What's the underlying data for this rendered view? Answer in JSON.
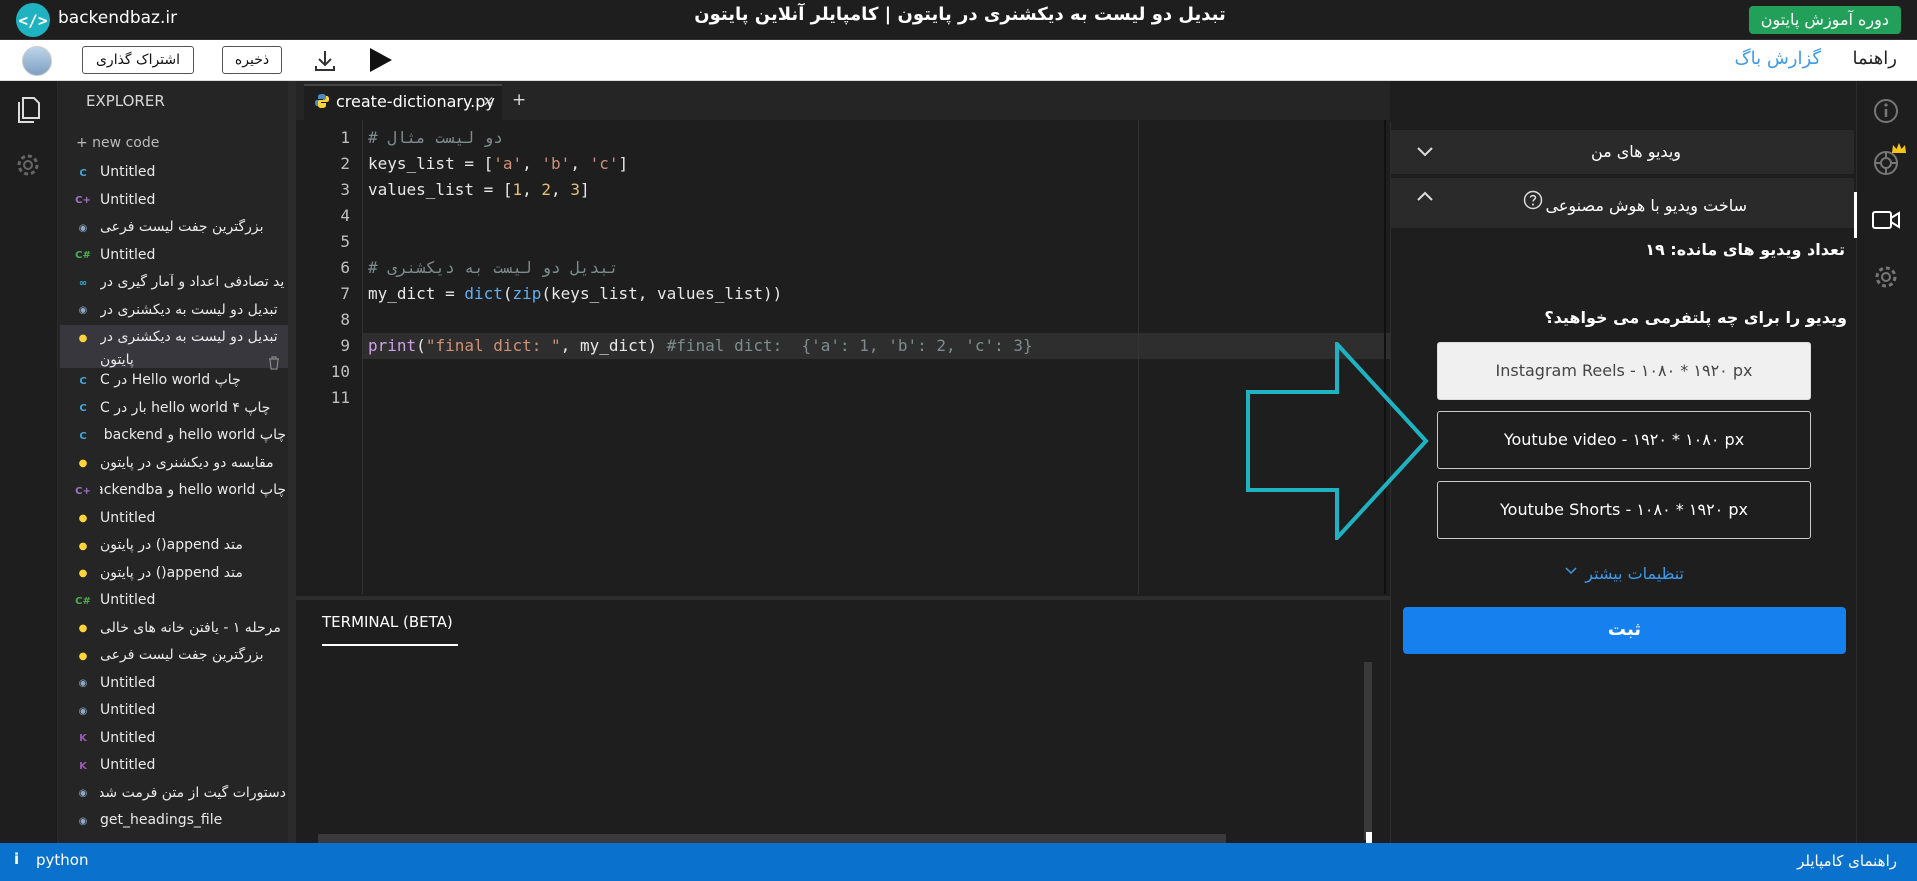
{
  "header": {
    "brand": "backendbaz.ir",
    "title": "تبدیل دو لیست به دیکشنری در پایتون | کامپایلر آنلاین پایتون",
    "course_button": "دوره آموزش پایتون"
  },
  "toolbar": {
    "share_label": "اشتراک گذاری",
    "save_label": "ذخیره",
    "guide_label": "راهنما",
    "bug_label": "گزارش باگ"
  },
  "explorer": {
    "title": "EXPLORER",
    "new_code": "+ new code",
    "files": [
      {
        "name": "Untitled",
        "icon": "c-icon",
        "color": "#3fa7dc"
      },
      {
        "name": "Untitled",
        "icon": "cpp-icon",
        "color": "#a074c4"
      },
      {
        "name": "بزرگترین جفت لیست فرعی",
        "icon": "generic-icon",
        "color": "#8aa7c4"
      },
      {
        "name": "Untitled",
        "icon": "csharp-icon",
        "color": "#4caf50"
      },
      {
        "name": "ید تصادفی اعداد و آمار گیری در",
        "icon": "infinity-icon",
        "color": "#33b5e5"
      },
      {
        "name": "تبدیل دو لیست به دیکشنری در",
        "icon": "generic-icon",
        "color": "#8aa7c4"
      },
      {
        "name": "تبدیل دو لیست به دیکشنری در",
        "name2": "پایتون",
        "icon": "python-icon",
        "color": "#ffd43b",
        "active": true
      },
      {
        "name": "چاپ Hello world در C",
        "icon": "c-icon",
        "color": "#3fa7dc"
      },
      {
        "name": "چاپ hello world ۴ بار در C",
        "icon": "c-icon",
        "color": "#3fa7dc"
      },
      {
        "name": "چاپ hello world و backend ر",
        "icon": "c-icon",
        "color": "#3fa7dc"
      },
      {
        "name": "مقایسه دو دیکشنری در پایتون",
        "icon": "python-icon",
        "color": "#ffd43b"
      },
      {
        "name": "چاپ hello world و backendba",
        "icon": "cpp-icon",
        "color": "#a074c4"
      },
      {
        "name": "Untitled",
        "icon": "python-icon",
        "color": "#ffd43b"
      },
      {
        "name": "متد append() در پایتون",
        "icon": "python-icon",
        "color": "#ffd43b"
      },
      {
        "name": "متد append() در پایتون",
        "icon": "python-icon",
        "color": "#ffd43b"
      },
      {
        "name": "Untitled",
        "icon": "csharp-icon",
        "color": "#4caf50"
      },
      {
        "name": "مرحله ۱ - یافتن خانه های خالی",
        "icon": "python-icon",
        "color": "#ffd43b"
      },
      {
        "name": "بزرگترین جفت لیست فرعی",
        "icon": "python-icon",
        "color": "#ffd43b"
      },
      {
        "name": "Untitled",
        "icon": "generic-icon",
        "color": "#8aa7c4"
      },
      {
        "name": "Untitled",
        "icon": "generic-icon",
        "color": "#8aa7c4"
      },
      {
        "name": "Untitled",
        "icon": "kotlin-icon",
        "color": "#9b59b6"
      },
      {
        "name": "Untitled",
        "icon": "kotlin-icon",
        "color": "#9b59b6"
      },
      {
        "name": "دستورات گیت از متن فرمت شده",
        "icon": "generic-icon",
        "color": "#8aa7c4"
      },
      {
        "name": "get_headings_file",
        "icon": "generic-icon",
        "color": "#8aa7c4"
      }
    ]
  },
  "editor": {
    "tab_filename": "create-dictionary.py",
    "tab_close": "×",
    "tab_add": "+",
    "line_numbers": [
      "1",
      "2",
      "3",
      "4",
      "5",
      "6",
      "7",
      "8",
      "9",
      "10",
      "11"
    ],
    "code": {
      "l1": "# دو لیست مثال",
      "l2a": "keys_list = [",
      "l2b": "'a'",
      "l2c": ", ",
      "l2d": "'b'",
      "l2e": ", ",
      "l2f": "'c'",
      "l2g": "]",
      "l3a": "values_list = [",
      "l3b": "1",
      "l3c": ", ",
      "l3d": "2",
      "l3e": ", ",
      "l3f": "3",
      "l3g": "]",
      "l6": "# تبدیل دو لیست به دیکشنری",
      "l7a": "my_dict = ",
      "l7b": "dict",
      "l7c": "(",
      "l7d": "zip",
      "l7e": "(keys_list, values_list))",
      "l9a": "print",
      "l9b": "(",
      "l9c": "\"final dict: \"",
      "l9d": ", my_dict) ",
      "l9e": "#final dict:  {'a': 1, 'b': 2, 'c': 3}"
    }
  },
  "terminal": {
    "title": "TERMINAL (BETA)"
  },
  "ai_panel": {
    "my_videos": "ویدیو های من",
    "make_video": "ساخت ویدیو با هوش مصنوعی",
    "remaining": "تعداد ویدیو های مانده: ۱۹",
    "platform_question": "ویدیو را برای چه پلتفرمی می خواهید؟",
    "options": [
      "Instagram Reels - ۱۰۸۰ * ۱۹۲۰ px",
      "Youtube video - ۱۹۲۰ * ۱۰۸۰ px",
      "Youtube Shorts - ۱۰۸۰ * ۱۹۲۰ px"
    ],
    "more_settings": "تنظیمات بیشتر",
    "submit": "ثبت"
  },
  "statusbar": {
    "info": "i",
    "language": "python",
    "compiler_guide": "راهنمای کامپایلر"
  },
  "colors": {
    "accent_blue": "#1680ef",
    "status_blue": "#0a72cc",
    "course_green": "#22a05a",
    "arrow_teal": "#1fb3c1"
  }
}
